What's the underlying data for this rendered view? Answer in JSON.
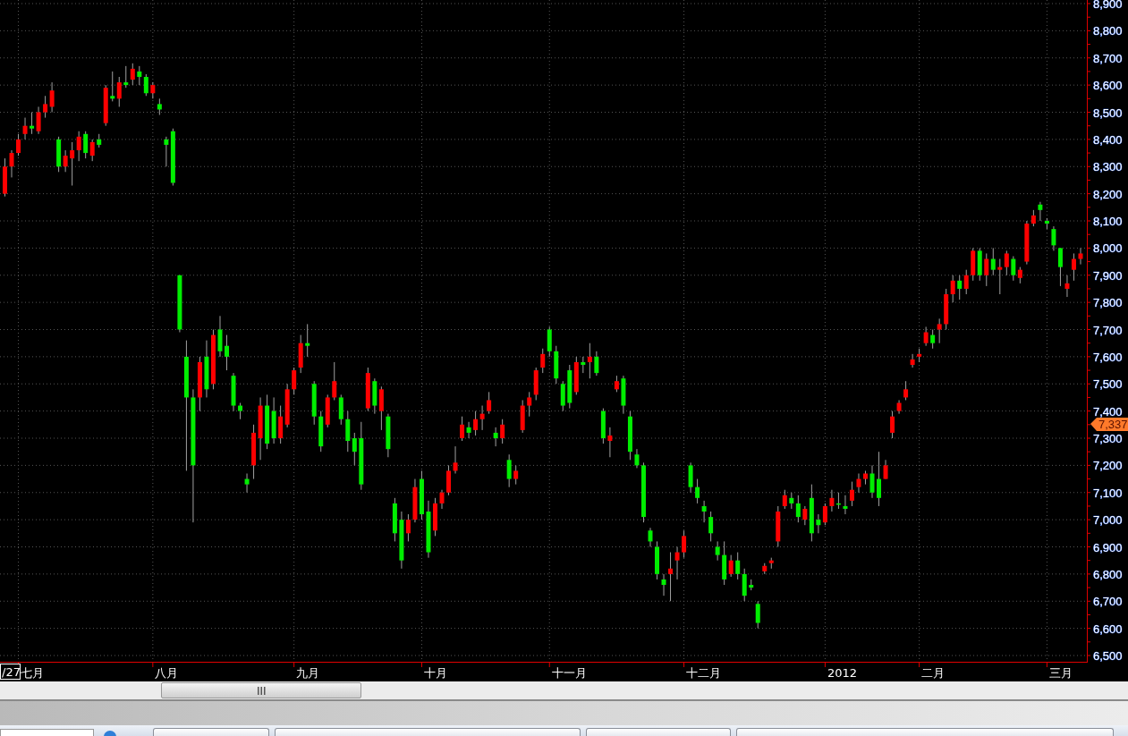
{
  "chart": {
    "chart_data": {
      "type": "candlestick",
      "ylim": [
        6500,
        8900
      ],
      "grid": true,
      "yticks": [
        {
          "value": 8900,
          "label": "8,900"
        },
        {
          "value": 8800,
          "label": "8,800"
        },
        {
          "value": 8700,
          "label": "8,700"
        },
        {
          "value": 8600,
          "label": "8,600"
        },
        {
          "value": 8500,
          "label": "8,500"
        },
        {
          "value": 8400,
          "label": "8,400"
        },
        {
          "value": 8300,
          "label": "8,300"
        },
        {
          "value": 8200,
          "label": "8,200"
        },
        {
          "value": 8100,
          "label": "8,100"
        },
        {
          "value": 8000,
          "label": "8,000"
        },
        {
          "value": 7900,
          "label": "7,900"
        },
        {
          "value": 7800,
          "label": "7,800"
        },
        {
          "value": 7700,
          "label": "7,700"
        },
        {
          "value": 7600,
          "label": "7,600"
        },
        {
          "value": 7500,
          "label": "7,500"
        },
        {
          "value": 7400,
          "label": "7,400"
        },
        {
          "value": 7300,
          "label": "7,300"
        },
        {
          "value": 7200,
          "label": "7,200"
        },
        {
          "value": 7100,
          "label": "7,100"
        },
        {
          "value": 7000,
          "label": "7,000"
        },
        {
          "value": 6900,
          "label": "6,900"
        },
        {
          "value": 6800,
          "label": "6,800"
        },
        {
          "value": 6700,
          "label": "6,700"
        },
        {
          "value": 6600,
          "label": "6,600"
        },
        {
          "value": 6500,
          "label": "6,500"
        }
      ],
      "ohlc": [
        [
          8200,
          8330,
          8190,
          8300
        ],
        [
          8300,
          8360,
          8260,
          8350
        ],
        [
          8350,
          8420,
          8340,
          8400
        ],
        [
          8420,
          8480,
          8400,
          8450
        ],
        [
          8450,
          8500,
          8420,
          8440
        ],
        [
          8430,
          8520,
          8420,
          8500
        ],
        [
          8500,
          8560,
          8480,
          8530
        ],
        [
          8520,
          8610,
          8500,
          8580
        ],
        [
          8400,
          8410,
          8280,
          8300
        ],
        [
          8300,
          8360,
          8280,
          8340
        ],
        [
          8330,
          8390,
          8230,
          8360
        ],
        [
          8360,
          8430,
          8320,
          8410
        ],
        [
          8420,
          8430,
          8330,
          8350
        ],
        [
          8340,
          8400,
          8320,
          8390
        ],
        [
          8400,
          8420,
          8370,
          8380
        ],
        [
          8460,
          8600,
          8450,
          8590
        ],
        [
          8560,
          8650,
          8540,
          8550
        ],
        [
          8550,
          8630,
          8520,
          8610
        ],
        [
          8610,
          8670,
          8590,
          8600
        ],
        [
          8620,
          8680,
          8600,
          8660
        ],
        [
          8650,
          8670,
          8600,
          8630
        ],
        [
          8630,
          8640,
          8560,
          8570
        ],
        [
          8570,
          8610,
          8550,
          8600
        ],
        [
          8530,
          8550,
          8490,
          8510
        ],
        [
          8400,
          8410,
          8300,
          8380
        ],
        [
          8430,
          8440,
          8230,
          8240
        ],
        [
          7900,
          7900,
          7690,
          7700
        ],
        [
          7600,
          7660,
          7180,
          7450
        ],
        [
          7450,
          7480,
          6990,
          7200
        ],
        [
          7450,
          7600,
          7400,
          7580
        ],
        [
          7600,
          7660,
          7450,
          7480
        ],
        [
          7500,
          7700,
          7480,
          7680
        ],
        [
          7700,
          7750,
          7600,
          7620
        ],
        [
          7640,
          7680,
          7550,
          7600
        ],
        [
          7530,
          7540,
          7400,
          7420
        ],
        [
          7420,
          7430,
          7370,
          7400
        ],
        [
          7150,
          7170,
          7100,
          7130
        ],
        [
          7200,
          7350,
          7150,
          7320
        ],
        [
          7300,
          7450,
          7220,
          7420
        ],
        [
          7420,
          7460,
          7260,
          7280
        ],
        [
          7400,
          7450,
          7280,
          7300
        ],
        [
          7300,
          7420,
          7280,
          7380
        ],
        [
          7350,
          7500,
          7340,
          7480
        ],
        [
          7480,
          7560,
          7460,
          7550
        ],
        [
          7560,
          7680,
          7540,
          7650
        ],
        [
          7650,
          7720,
          7600,
          7640
        ],
        [
          7500,
          7510,
          7350,
          7380
        ],
        [
          7380,
          7400,
          7250,
          7270
        ],
        [
          7350,
          7460,
          7340,
          7450
        ],
        [
          7450,
          7580,
          7440,
          7510
        ],
        [
          7450,
          7460,
          7350,
          7370
        ],
        [
          7370,
          7400,
          7250,
          7290
        ],
        [
          7300,
          7320,
          7200,
          7250
        ],
        [
          7300,
          7360,
          7110,
          7130
        ],
        [
          7410,
          7560,
          7400,
          7540
        ],
        [
          7510,
          7520,
          7390,
          7420
        ],
        [
          7400,
          7490,
          7330,
          7480
        ],
        [
          7380,
          7390,
          7230,
          7260
        ],
        [
          7060,
          7080,
          6920,
          6950
        ],
        [
          7000,
          7030,
          6820,
          6850
        ],
        [
          6950,
          7020,
          6920,
          7000
        ],
        [
          7000,
          7150,
          6990,
          7120
        ],
        [
          7150,
          7180,
          7000,
          7020
        ],
        [
          7030,
          7070,
          6860,
          6880
        ],
        [
          6960,
          7080,
          6940,
          7060
        ],
        [
          7060,
          7110,
          7040,
          7100
        ],
        [
          7100,
          7200,
          7090,
          7180
        ],
        [
          7180,
          7270,
          7170,
          7210
        ],
        [
          7300,
          7380,
          7290,
          7350
        ],
        [
          7340,
          7360,
          7300,
          7320
        ],
        [
          7330,
          7400,
          7310,
          7370
        ],
        [
          7370,
          7420,
          7330,
          7390
        ],
        [
          7400,
          7470,
          7390,
          7440
        ],
        [
          7320,
          7340,
          7270,
          7300
        ],
        [
          7300,
          7370,
          7280,
          7350
        ],
        [
          7220,
          7240,
          7120,
          7150
        ],
        [
          7150,
          7200,
          7130,
          7180
        ],
        [
          7330,
          7440,
          7320,
          7420
        ],
        [
          7420,
          7470,
          7380,
          7450
        ],
        [
          7460,
          7560,
          7440,
          7550
        ],
        [
          7560,
          7630,
          7540,
          7610
        ],
        [
          7700,
          7710,
          7600,
          7620
        ],
        [
          7620,
          7640,
          7500,
          7520
        ],
        [
          7500,
          7510,
          7400,
          7420
        ],
        [
          7550,
          7570,
          7410,
          7430
        ],
        [
          7470,
          7600,
          7460,
          7580
        ],
        [
          7580,
          7600,
          7540,
          7570
        ],
        [
          7580,
          7650,
          7520,
          7600
        ],
        [
          7600,
          7620,
          7530,
          7540
        ],
        [
          7400,
          7410,
          7280,
          7300
        ],
        [
          7290,
          7340,
          7230,
          7310
        ],
        [
          7480,
          7530,
          7470,
          7510
        ],
        [
          7520,
          7530,
          7390,
          7420
        ],
        [
          7380,
          7400,
          7220,
          7250
        ],
        [
          7240,
          7260,
          7190,
          7200
        ],
        [
          7200,
          7210,
          6990,
          7010
        ],
        [
          6960,
          6970,
          6900,
          6920
        ],
        [
          6900,
          6920,
          6780,
          6800
        ],
        [
          6780,
          6800,
          6720,
          6760
        ],
        [
          6800,
          6880,
          6700,
          6820
        ],
        [
          6850,
          6900,
          6780,
          6880
        ],
        [
          6880,
          6960,
          6860,
          6940
        ],
        [
          7200,
          7210,
          7100,
          7120
        ],
        [
          7120,
          7150,
          7060,
          7080
        ],
        [
          7050,
          7070,
          6990,
          7030
        ],
        [
          7010,
          7030,
          6920,
          6950
        ],
        [
          6900,
          6920,
          6850,
          6870
        ],
        [
          6870,
          6920,
          6760,
          6780
        ],
        [
          6800,
          6870,
          6790,
          6850
        ],
        [
          6850,
          6880,
          6780,
          6800
        ],
        [
          6800,
          6820,
          6700,
          6720
        ],
        [
          6760,
          6780,
          6740,
          6750
        ],
        [
          6690,
          6700,
          6600,
          6620
        ],
        [
          6810,
          6840,
          6800,
          6830
        ],
        [
          6840,
          6860,
          6820,
          6850
        ],
        [
          6920,
          7050,
          6900,
          7030
        ],
        [
          7050,
          7110,
          7040,
          7090
        ],
        [
          7080,
          7100,
          7040,
          7060
        ],
        [
          7060,
          7090,
          6990,
          7010
        ],
        [
          7000,
          7050,
          6980,
          7040
        ],
        [
          7080,
          7130,
          6920,
          6950
        ],
        [
          7000,
          7020,
          6950,
          6980
        ],
        [
          6990,
          7060,
          6980,
          7050
        ],
        [
          7050,
          7110,
          7030,
          7080
        ],
        [
          7060,
          7100,
          7040,
          7060
        ],
        [
          7050,
          7090,
          7020,
          7040
        ],
        [
          7070,
          7140,
          7050,
          7110
        ],
        [
          7120,
          7170,
          7100,
          7150
        ],
        [
          7150,
          7180,
          7130,
          7170
        ],
        [
          7170,
          7200,
          7080,
          7100
        ],
        [
          7150,
          7250,
          7050,
          7080
        ],
        [
          7150,
          7220,
          7150,
          7200
        ],
        [
          7320,
          7400,
          7300,
          7380
        ],
        [
          7400,
          7440,
          7390,
          7430
        ],
        [
          7450,
          7510,
          7440,
          7480
        ],
        [
          7570,
          7610,
          7560,
          7590
        ],
        [
          7600,
          7630,
          7580,
          7610
        ],
        [
          7650,
          7710,
          7640,
          7690
        ],
        [
          7680,
          7700,
          7630,
          7650
        ],
        [
          7700,
          7740,
          7650,
          7720
        ],
        [
          7720,
          7850,
          7700,
          7830
        ],
        [
          7830,
          7900,
          7800,
          7880
        ],
        [
          7880,
          7900,
          7810,
          7850
        ],
        [
          7850,
          7920,
          7830,
          7900
        ],
        [
          7900,
          8000,
          7880,
          7990
        ],
        [
          7990,
          8000,
          7880,
          7900
        ],
        [
          7900,
          7980,
          7860,
          7960
        ],
        [
          7960,
          8000,
          7900,
          7920
        ],
        [
          7920,
          7960,
          7830,
          7930
        ],
        [
          7930,
          7990,
          7900,
          7980
        ],
        [
          7960,
          7970,
          7880,
          7900
        ],
        [
          7890,
          7930,
          7870,
          7920
        ],
        [
          7950,
          8100,
          7940,
          8090
        ],
        [
          8090,
          8140,
          8080,
          8120
        ],
        [
          8160,
          8170,
          8100,
          8140
        ],
        [
          8100,
          8110,
          8070,
          8090
        ],
        [
          8070,
          8080,
          7990,
          8010
        ],
        [
          8000,
          8000,
          7860,
          7930
        ],
        [
          7850,
          7900,
          7820,
          7870
        ],
        [
          7920,
          7980,
          7880,
          7960
        ],
        [
          7960,
          8000,
          7940,
          7980
        ]
      ]
    },
    "x_axis_labels": [
      "七月",
      "八月",
      "九月",
      "十月",
      "十一月",
      "十二月",
      "2012",
      "二月",
      "三月"
    ],
    "cursor_date": "/27",
    "last_price": "7,337"
  }
}
